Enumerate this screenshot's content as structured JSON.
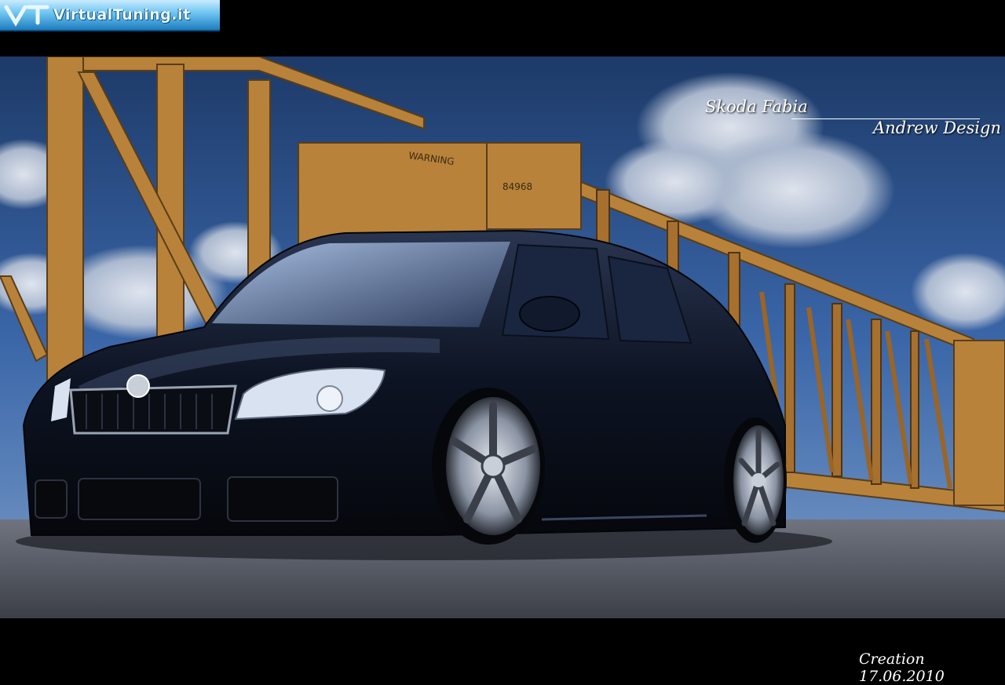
{
  "logo": {
    "text": "VirtualTuning.it"
  },
  "overlay": {
    "title": "Skoda Fabia",
    "author": "Andrew Design",
    "creation": "Creation 17.06.2010"
  },
  "scene": {
    "sign_text": "WARNING",
    "plate_number": "84968",
    "colors": {
      "sky": "#2a4f86",
      "bridge": "#b8823a",
      "car": "#0d1626",
      "ground": "#8d8f96"
    }
  }
}
